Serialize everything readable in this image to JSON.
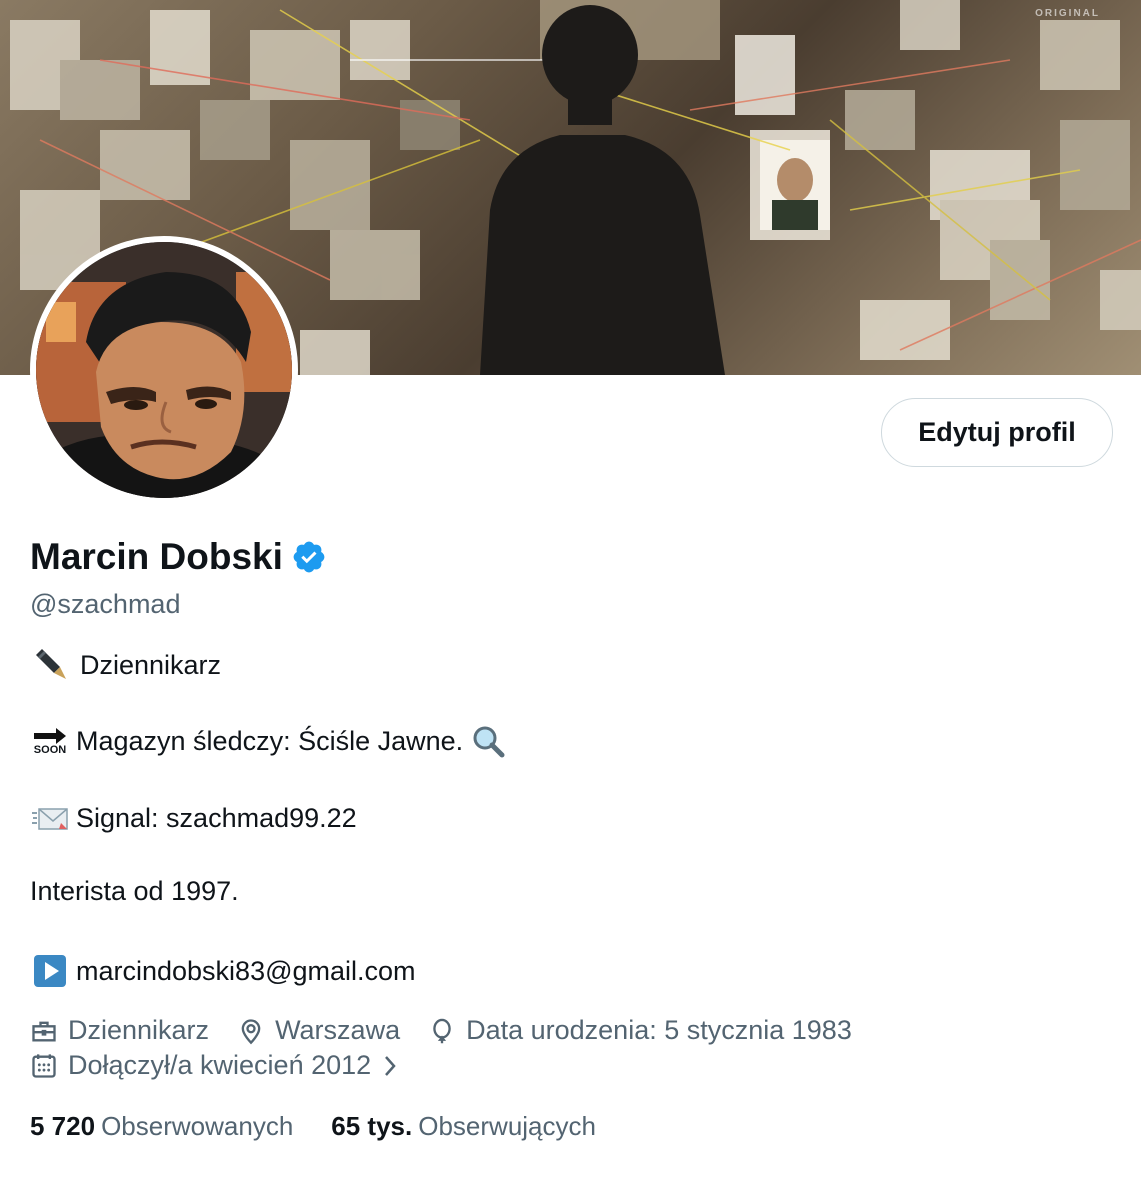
{
  "banner": {
    "watermark": "ORIGINAL"
  },
  "profile": {
    "edit_button_label": "Edytuj profil",
    "name": "Marcin Dobski",
    "handle": "@szachmad",
    "verified_color": "#1d9bf0"
  },
  "bio": {
    "line1": "Dziennikarz",
    "line2": "Magazyn śledczy: Ściśle Jawne.",
    "line3": "Signal: szachmad99.22",
    "line4": "Interista od 1997.",
    "line5": "marcindobski83@gmail.com",
    "soon_label": "SOON"
  },
  "meta": {
    "profession": "Dziennikarz",
    "location": "Warszawa",
    "birthday": "Data urodzenia: 5 stycznia 1983",
    "joined": "Dołączył/a kwiecień 2012"
  },
  "stats": {
    "following_count": "5 720",
    "following_label": "Obserwowanych",
    "followers_count": "65 tys.",
    "followers_label": "Obserwujących"
  },
  "colors": {
    "text": "#0f1419",
    "secondary": "#536471",
    "accent": "#1d9bf0",
    "border": "#cfd9de"
  }
}
